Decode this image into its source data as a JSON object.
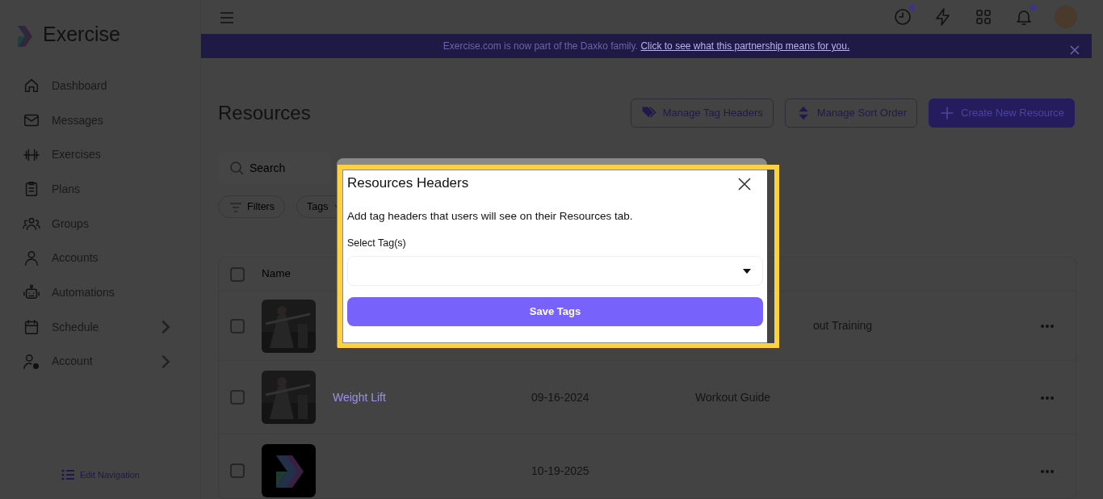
{
  "sidebar": {
    "brand": "Exercise",
    "items": [
      {
        "label": "Dashboard",
        "kind": "home",
        "expandable": false
      },
      {
        "label": "Messages",
        "kind": "mail",
        "expandable": false
      },
      {
        "label": "Exercises",
        "kind": "dumbbell",
        "expandable": false
      },
      {
        "label": "Plans",
        "kind": "clipboard",
        "expandable": false
      },
      {
        "label": "Groups",
        "kind": "group",
        "expandable": false
      },
      {
        "label": "Accounts",
        "kind": "person",
        "expandable": false
      },
      {
        "label": "Automations",
        "kind": "robot",
        "expandable": false
      },
      {
        "label": "Schedule",
        "kind": "calendar",
        "expandable": true
      },
      {
        "label": "Account",
        "kind": "usergear",
        "expandable": true
      }
    ],
    "edit_navigation": "Edit Navigation"
  },
  "topbar": {
    "icons": [
      {
        "kind": "clock",
        "dot": true
      },
      {
        "kind": "bolt",
        "dot": false
      },
      {
        "kind": "grid",
        "dot": false
      },
      {
        "kind": "bell",
        "dot": true
      }
    ]
  },
  "banner": {
    "text": "Exercise.com is now part of the Daxko family.",
    "link": "Click to see what this partnership means for you."
  },
  "page": {
    "title": "Resources",
    "actions": [
      {
        "label": "Manage Tag Headers",
        "kind": "tag"
      },
      {
        "label": "Manage Sort Order",
        "kind": "sort"
      },
      {
        "label": "Create New Resource",
        "kind": "create"
      }
    ],
    "search": {
      "placeholder": "Search"
    },
    "chips": [
      {
        "label": "Filters",
        "kind": "filter"
      },
      {
        "label": "Tags",
        "kind": "dropdown"
      }
    ]
  },
  "table": {
    "columns": [
      "Name"
    ],
    "header_checked": false,
    "rows": [
      {
        "kind": "obscured",
        "tag": "out Training",
        "checked": false
      },
      {
        "kind": "full",
        "name": "Weight Lift",
        "date": "09-16-2024",
        "tag": "Workout Guide",
        "checked": false
      },
      {
        "kind": "full",
        "thumb": {
          "kind": "logo"
        },
        "date": "10-19-2025",
        "checked": false
      }
    ]
  },
  "modal": {
    "title": "Resources Headers",
    "description": "Add tag headers that users will see on their Resources tab.",
    "field_label": "Select Tag(s)",
    "button": "Save Tags"
  }
}
